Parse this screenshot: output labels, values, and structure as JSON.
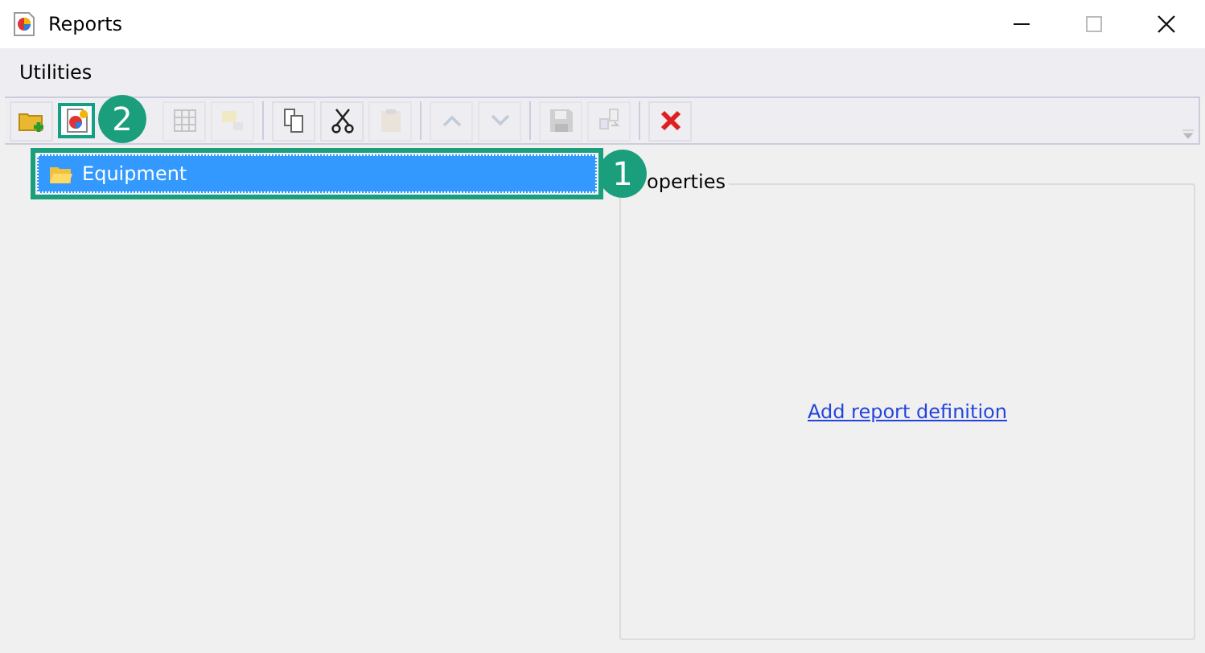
{
  "window": {
    "title": "Reports"
  },
  "menu": [
    {
      "label": "Utilities"
    }
  ],
  "toolbar": [
    {
      "kind": "new-folder",
      "disabled": false
    },
    {
      "kind": "new-report",
      "disabled": false,
      "callout": "2"
    },
    {
      "kind": "gap"
    },
    {
      "kind": "grid",
      "disabled": true
    },
    {
      "kind": "comment",
      "disabled": true
    },
    {
      "kind": "separator"
    },
    {
      "kind": "copy",
      "disabled": false
    },
    {
      "kind": "cut",
      "disabled": false
    },
    {
      "kind": "paste",
      "disabled": true
    },
    {
      "kind": "separator"
    },
    {
      "kind": "up",
      "disabled": true
    },
    {
      "kind": "down",
      "disabled": true
    },
    {
      "kind": "separator"
    },
    {
      "kind": "save",
      "disabled": true
    },
    {
      "kind": "export",
      "disabled": true
    },
    {
      "kind": "separator"
    },
    {
      "kind": "delete",
      "disabled": false
    }
  ],
  "tree": [
    {
      "label": "Equipment",
      "selected": true,
      "callout": "1"
    }
  ],
  "properties": {
    "legend": "operties",
    "link": "Add report definition"
  }
}
